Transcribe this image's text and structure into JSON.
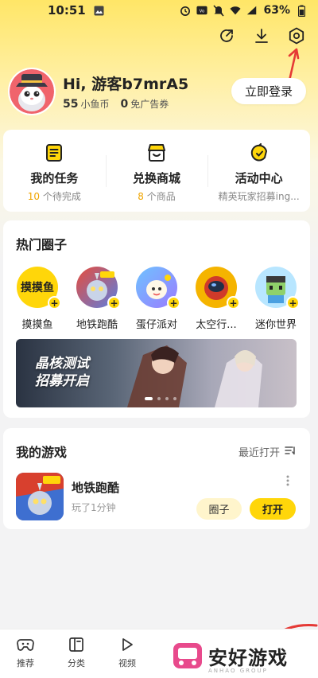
{
  "status_bar": {
    "time": "10:51",
    "battery": "63%"
  },
  "top_icons": [
    "share-icon",
    "download-icon",
    "settings-icon"
  ],
  "profile": {
    "greeting": "Hi, 游客b7mrA5",
    "coins_count": "55",
    "coins_label": "小鱼币",
    "coupons_count": "0",
    "coupons_label": "免广告券",
    "login_label": "立即登录"
  },
  "quick_menu": [
    {
      "icon": "task-icon",
      "title": "我的任务",
      "highlight": "10",
      "sub": " 个待完成"
    },
    {
      "icon": "shop-icon",
      "title": "兑换商城",
      "highlight": "8",
      "sub": " 个商品"
    },
    {
      "icon": "activity-icon",
      "title": "活动中心",
      "highlight": "",
      "sub": "精英玩家招募ing..."
    }
  ],
  "hot_circles": {
    "title": "热门圈子",
    "items": [
      {
        "label": "摸摸鱼",
        "logo_text": "摸摸鱼"
      },
      {
        "label": "地铁跑酷"
      },
      {
        "label": "蛋仔派对"
      },
      {
        "label": "太空行..."
      },
      {
        "label": "迷你世界"
      }
    ],
    "banner": {
      "line1": "晶核测试",
      "line2": "招募开启"
    }
  },
  "my_games": {
    "title": "我的游戏",
    "recent_label": "最近打开",
    "games": [
      {
        "name": "地铁跑酷",
        "played": "玩了1分钟",
        "circle_label": "圈子",
        "open_label": "打开"
      }
    ]
  },
  "bottom_nav": [
    {
      "icon": "gamepad-icon",
      "label": "推荐"
    },
    {
      "icon": "category-icon",
      "label": "分类"
    },
    {
      "icon": "video-icon",
      "label": "视频"
    }
  ],
  "watermark": {
    "text": "安好游戏",
    "sub": "ANHAO GROUP"
  },
  "colors": {
    "accent": "#ffd60a",
    "highlight": "#f0a500",
    "annotation": "#e53935"
  }
}
